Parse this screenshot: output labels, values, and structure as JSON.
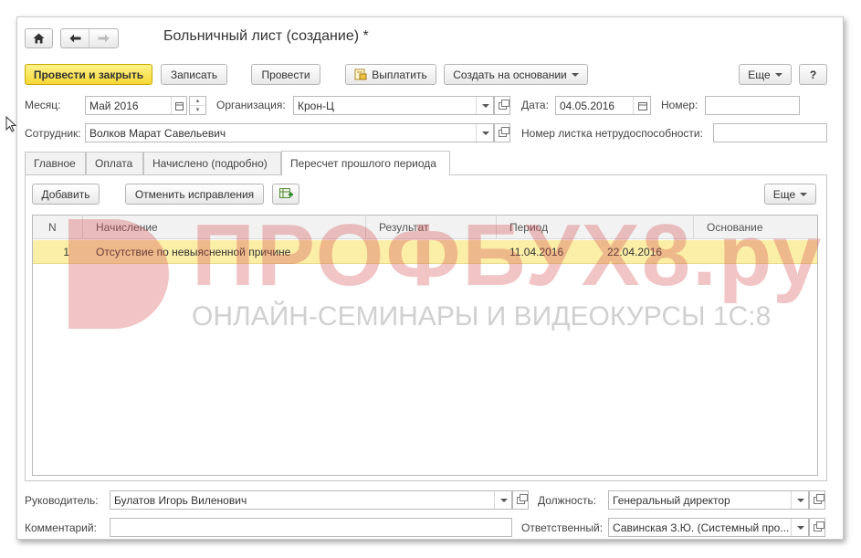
{
  "window": {
    "title": "Больничный лист (создание) *"
  },
  "toolbar": {
    "post_close": "Провести и закрыть",
    "save": "Записать",
    "post": "Провести",
    "pay": "Выплатить",
    "create_based": "Создать на основании",
    "more": "Еще",
    "help": "?"
  },
  "form": {
    "month_label": "Месяц:",
    "month_value": "Май 2016",
    "org_label": "Организация:",
    "org_value": "Крон-Ц",
    "date_label": "Дата:",
    "date_value": "04.05.2016",
    "number_label": "Номер:",
    "number_value": "",
    "employee_label": "Сотрудник:",
    "employee_value": "Волков Марат Савельевич",
    "sheet_number_label": "Номер листка нетрудоспособности:",
    "sheet_number_value": ""
  },
  "tabs": [
    {
      "label": "Главное"
    },
    {
      "label": "Оплата"
    },
    {
      "label": "Начислено (подробно)"
    },
    {
      "label": "Пересчет прошлого периода"
    }
  ],
  "tab_toolbar": {
    "add": "Добавить",
    "cancel_fix": "Отменить исправления",
    "more": "Еще"
  },
  "table": {
    "columns": [
      "N",
      "Начисление",
      "Результат",
      "Период",
      "Основание"
    ],
    "rows": [
      {
        "n": "1",
        "accrual": "Отсутствие по невыясненной причине",
        "result": "",
        "period_from": "11.04.2016",
        "period_to": "22.04.2016",
        "basis": ""
      }
    ]
  },
  "watermark": {
    "big": "ПРОФБУХ8.ру",
    "small": "ОНЛАЙН-СЕМИНАРЫ И ВИДЕОКУРСЫ 1С:8"
  },
  "footer": {
    "manager_label": "Руководитель:",
    "manager_value": "Булатов Игорь Виленович",
    "position_label": "Должность:",
    "position_value": "Генеральный директор",
    "comment_label": "Комментарий:",
    "comment_value": "",
    "responsible_label": "Ответственный:",
    "responsible_value": "Савинская З.Ю. (Системный про..."
  }
}
